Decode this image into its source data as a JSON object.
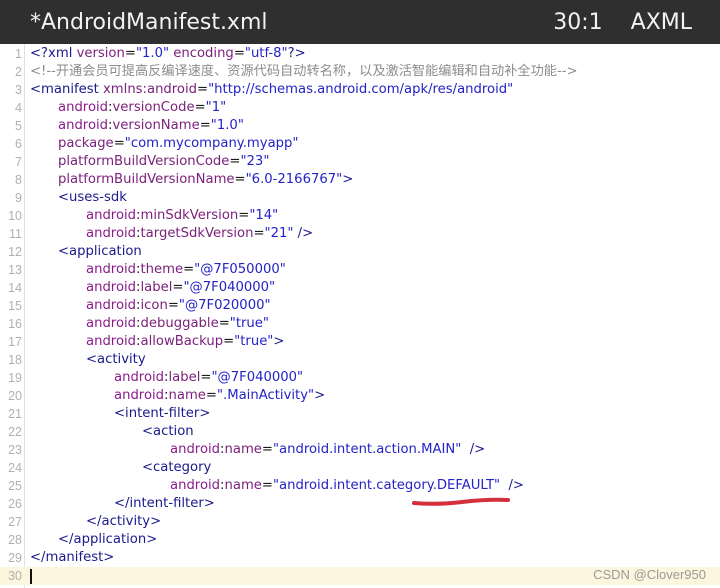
{
  "titlebar": {
    "filename": "*AndroidManifest.xml",
    "cursor_position": "30:1",
    "language": "AXML"
  },
  "editor": {
    "lines": [
      {
        "n": "1",
        "indent": 0,
        "tokens": [
          [
            "tag",
            "<?xml "
          ],
          [
            "attr",
            "version"
          ],
          [
            "txt",
            "="
          ],
          [
            "val",
            "\"1.0\""
          ],
          [
            "txt",
            " "
          ],
          [
            "attr",
            "encoding"
          ],
          [
            "txt",
            "="
          ],
          [
            "val",
            "\"utf-8\""
          ],
          [
            "tag",
            "?>"
          ]
        ]
      },
      {
        "n": "2",
        "indent": 0,
        "tokens": [
          [
            "com",
            "<!--开通会员可提高反编译速度、资源代码自动转名称，以及激活智能编辑和自动补全功能-->"
          ]
        ]
      },
      {
        "n": "3",
        "indent": 0,
        "tokens": [
          [
            "tag",
            "<manifest "
          ],
          [
            "attr",
            "xmlns:android"
          ],
          [
            "txt",
            "="
          ],
          [
            "val",
            "\"http://schemas.android.com/apk/res/android\""
          ]
        ]
      },
      {
        "n": "4",
        "indent": 1,
        "tokens": [
          [
            "ns",
            "android"
          ],
          [
            "txt",
            ":"
          ],
          [
            "attr",
            "versionCode"
          ],
          [
            "txt",
            "="
          ],
          [
            "val",
            "\"1\""
          ]
        ]
      },
      {
        "n": "5",
        "indent": 1,
        "tokens": [
          [
            "ns",
            "android"
          ],
          [
            "txt",
            ":"
          ],
          [
            "attr",
            "versionName"
          ],
          [
            "txt",
            "="
          ],
          [
            "val",
            "\"1.0\""
          ]
        ]
      },
      {
        "n": "6",
        "indent": 1,
        "tokens": [
          [
            "attr",
            "package"
          ],
          [
            "txt",
            "="
          ],
          [
            "val",
            "\"com.mycompany.myapp\""
          ]
        ]
      },
      {
        "n": "7",
        "indent": 1,
        "tokens": [
          [
            "attr",
            "platformBuildVersionCode"
          ],
          [
            "txt",
            "="
          ],
          [
            "val",
            "\"23\""
          ]
        ]
      },
      {
        "n": "8",
        "indent": 1,
        "tokens": [
          [
            "attr",
            "platformBuildVersionName"
          ],
          [
            "txt",
            "="
          ],
          [
            "val",
            "\"6.0-2166767\""
          ],
          [
            "tag",
            ">"
          ]
        ]
      },
      {
        "n": "9",
        "indent": 1,
        "tokens": [
          [
            "tag",
            "<uses-sdk"
          ]
        ]
      },
      {
        "n": "10",
        "indent": 2,
        "tokens": [
          [
            "ns",
            "android"
          ],
          [
            "txt",
            ":"
          ],
          [
            "attr",
            "minSdkVersion"
          ],
          [
            "txt",
            "="
          ],
          [
            "val",
            "\"14\""
          ]
        ]
      },
      {
        "n": "11",
        "indent": 2,
        "tokens": [
          [
            "ns",
            "android"
          ],
          [
            "txt",
            ":"
          ],
          [
            "attr",
            "targetSdkVersion"
          ],
          [
            "txt",
            "="
          ],
          [
            "val",
            "\"21\""
          ],
          [
            "tag",
            " />"
          ]
        ]
      },
      {
        "n": "12",
        "indent": 1,
        "tokens": [
          [
            "tag",
            "<application"
          ]
        ]
      },
      {
        "n": "13",
        "indent": 2,
        "tokens": [
          [
            "ns",
            "android"
          ],
          [
            "txt",
            ":"
          ],
          [
            "attr",
            "theme"
          ],
          [
            "txt",
            "="
          ],
          [
            "val",
            "\"@7F050000\""
          ]
        ]
      },
      {
        "n": "14",
        "indent": 2,
        "tokens": [
          [
            "ns",
            "android"
          ],
          [
            "txt",
            ":"
          ],
          [
            "attr",
            "label"
          ],
          [
            "txt",
            "="
          ],
          [
            "val",
            "\"@7F040000\""
          ]
        ]
      },
      {
        "n": "15",
        "indent": 2,
        "tokens": [
          [
            "ns",
            "android"
          ],
          [
            "txt",
            ":"
          ],
          [
            "attr",
            "icon"
          ],
          [
            "txt",
            "="
          ],
          [
            "val",
            "\"@7F020000\""
          ]
        ]
      },
      {
        "n": "16",
        "indent": 2,
        "tokens": [
          [
            "ns",
            "android"
          ],
          [
            "txt",
            ":"
          ],
          [
            "attr",
            "debuggable"
          ],
          [
            "txt",
            "="
          ],
          [
            "val",
            "\"true\""
          ]
        ]
      },
      {
        "n": "17",
        "indent": 2,
        "tokens": [
          [
            "ns",
            "android"
          ],
          [
            "txt",
            ":"
          ],
          [
            "attr",
            "allowBackup"
          ],
          [
            "txt",
            "="
          ],
          [
            "val",
            "\"true\""
          ],
          [
            "tag",
            ">"
          ]
        ]
      },
      {
        "n": "18",
        "indent": 2,
        "tokens": [
          [
            "tag",
            "<activity"
          ]
        ]
      },
      {
        "n": "19",
        "indent": 3,
        "tokens": [
          [
            "ns",
            "android"
          ],
          [
            "txt",
            ":"
          ],
          [
            "attr",
            "label"
          ],
          [
            "txt",
            "="
          ],
          [
            "val",
            "\"@7F040000\""
          ]
        ]
      },
      {
        "n": "20",
        "indent": 3,
        "tokens": [
          [
            "ns",
            "android"
          ],
          [
            "txt",
            ":"
          ],
          [
            "attr",
            "name"
          ],
          [
            "txt",
            "="
          ],
          [
            "val",
            "\".MainActivity\""
          ],
          [
            "tag",
            ">"
          ]
        ]
      },
      {
        "n": "21",
        "indent": 3,
        "tokens": [
          [
            "tag",
            "<intent-filter>"
          ]
        ]
      },
      {
        "n": "22",
        "indent": 4,
        "tokens": [
          [
            "tag",
            "<action"
          ]
        ]
      },
      {
        "n": "23",
        "indent": 5,
        "tokens": [
          [
            "ns",
            "android"
          ],
          [
            "txt",
            ":"
          ],
          [
            "attr",
            "name"
          ],
          [
            "txt",
            "="
          ],
          [
            "val",
            "\"android.intent.action.MAIN\""
          ],
          [
            "tag",
            "  />"
          ]
        ]
      },
      {
        "n": "24",
        "indent": 4,
        "tokens": [
          [
            "tag",
            "<category"
          ]
        ]
      },
      {
        "n": "25",
        "indent": 5,
        "tokens": [
          [
            "ns",
            "android"
          ],
          [
            "txt",
            ":"
          ],
          [
            "attr",
            "name"
          ],
          [
            "txt",
            "="
          ],
          [
            "val",
            "\"android.intent.category.DEFAULT\""
          ],
          [
            "tag",
            "  />"
          ]
        ]
      },
      {
        "n": "26",
        "indent": 3,
        "tokens": [
          [
            "tag",
            "</intent-filter>"
          ]
        ]
      },
      {
        "n": "27",
        "indent": 2,
        "tokens": [
          [
            "tag",
            "</activity>"
          ]
        ]
      },
      {
        "n": "28",
        "indent": 1,
        "tokens": [
          [
            "tag",
            "</application>"
          ]
        ]
      },
      {
        "n": "29",
        "indent": 0,
        "tokens": [
          [
            "tag",
            "</manifest>"
          ]
        ]
      },
      {
        "n": "30",
        "indent": 0,
        "tokens": []
      }
    ],
    "current_line": "30",
    "annotation_color": "#d3303b"
  },
  "watermark": "CSDN @Clover950"
}
